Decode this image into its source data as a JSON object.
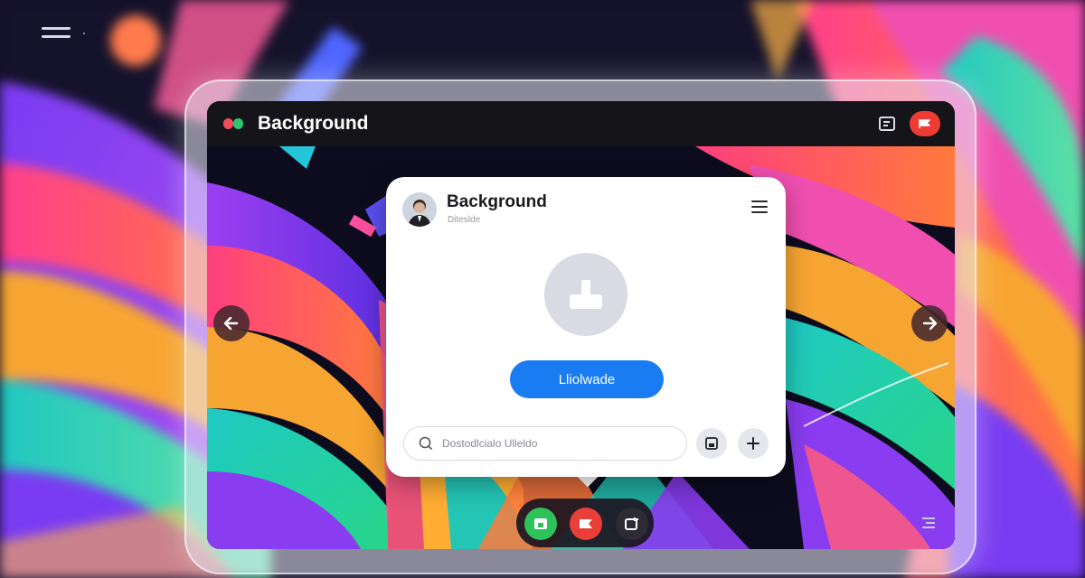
{
  "window": {
    "title": "Background",
    "colors": {
      "titlebar": "#151418",
      "accent_red": "#ee3b33",
      "accent_green": "#2ec25a"
    },
    "icons": {
      "app": "app-logo-icon",
      "doc": "document-icon",
      "flag": "flag-icon"
    }
  },
  "card": {
    "title": "Background",
    "subtitle": "Diteslde",
    "upload_label": "Lliolwade",
    "search_placeholder": "Dostodlcialo Ulleldo",
    "icons": {
      "menu": "hamburger-icon",
      "upload": "upload-icon",
      "search": "search-icon",
      "save": "save-icon",
      "add": "plus-icon"
    },
    "accent": "#1a7cf2"
  },
  "dock": {
    "icons": [
      "app-icon",
      "flag-icon",
      "crop-icon"
    ],
    "colors": [
      "#2ec25a",
      "#ea3f38",
      "#2d2c34"
    ]
  },
  "nav": {
    "left": "arrow-left-icon",
    "right": "arrow-right-icon"
  }
}
